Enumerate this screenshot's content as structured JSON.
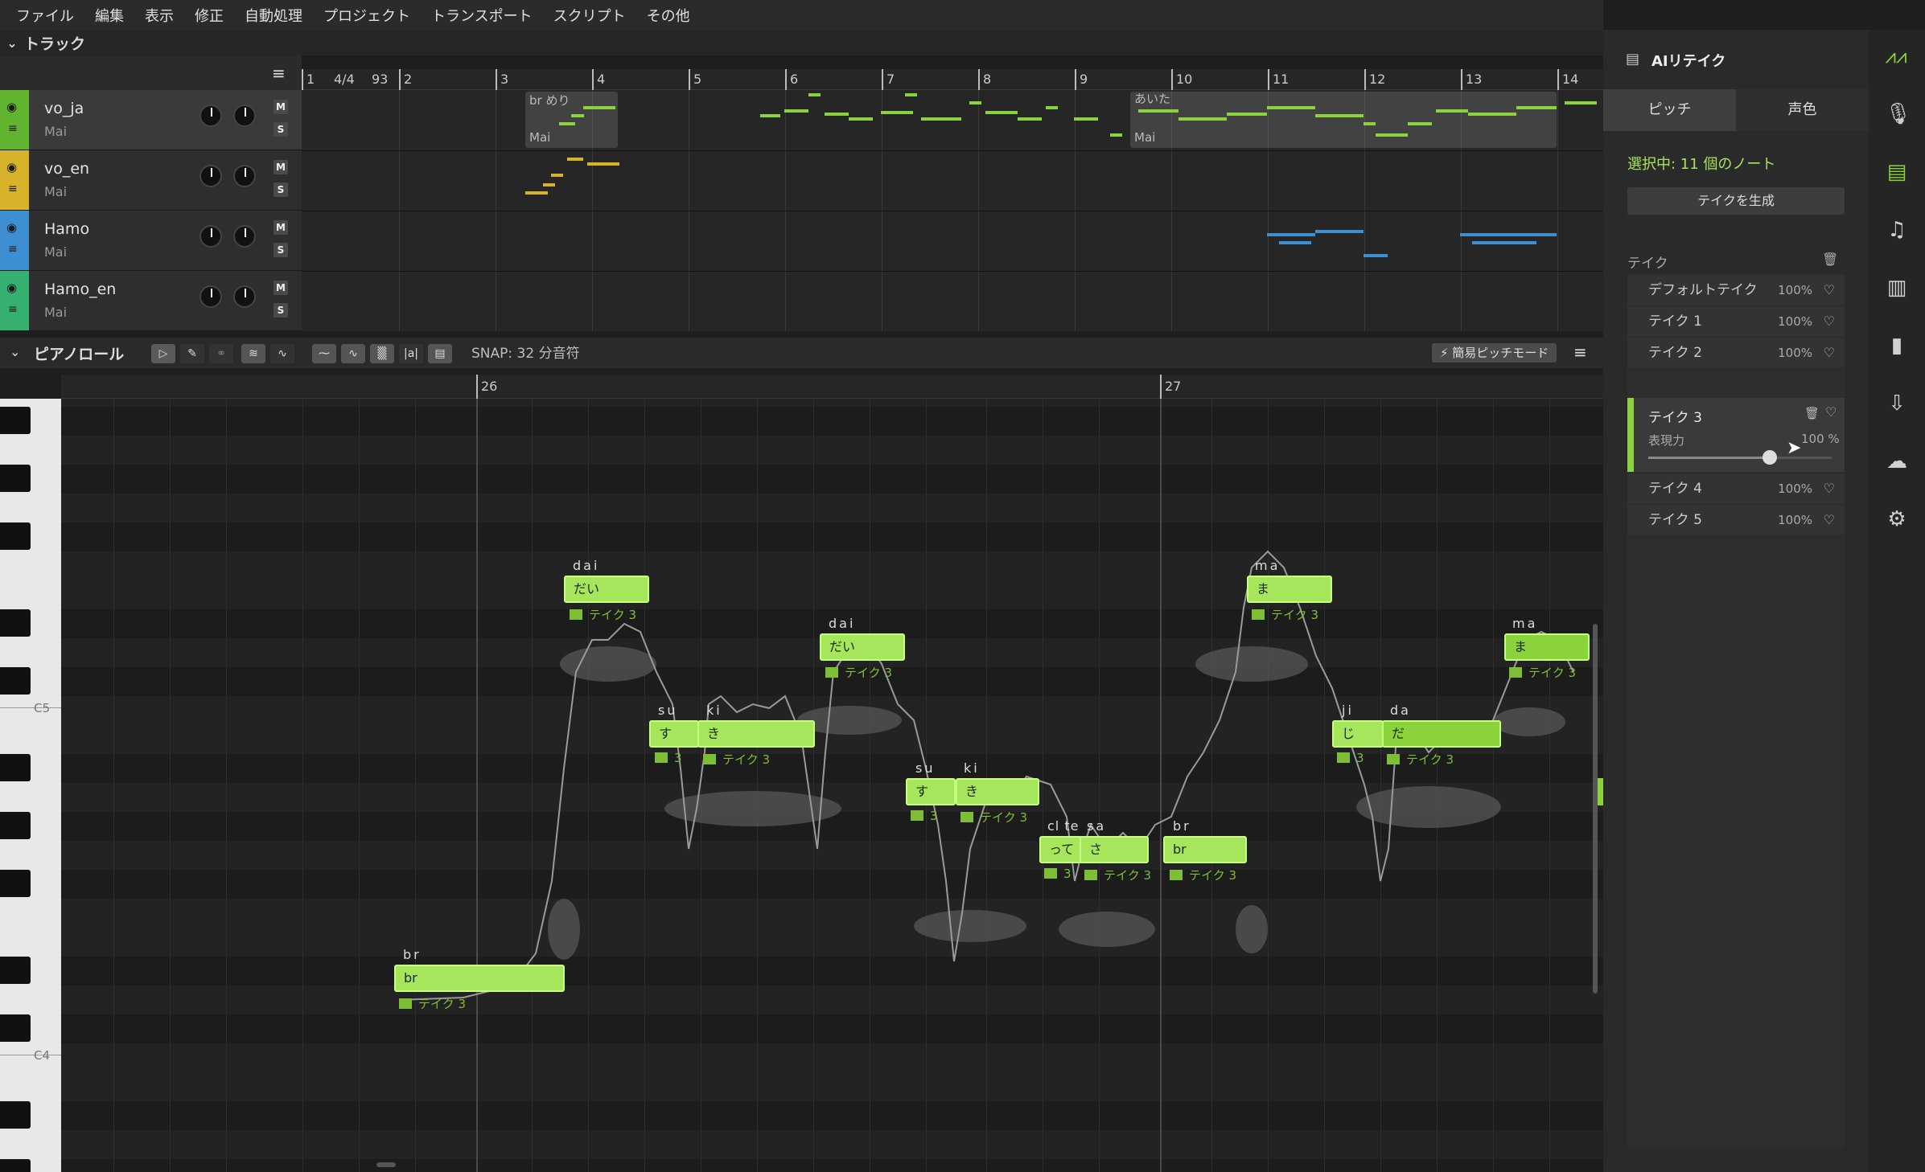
{
  "menu": [
    "ファイル",
    "編集",
    "表示",
    "修正",
    "自動処理",
    "プロジェクト",
    "トランスポート",
    "スクリプト",
    "その他"
  ],
  "tracks_section": {
    "title": "トラック"
  },
  "ruler": {
    "time_sig": "4/4",
    "tempo": "93",
    "bars": [
      "1",
      "2",
      "3",
      "4",
      "5",
      "6",
      "7",
      "8",
      "9",
      "10",
      "11",
      "12",
      "13",
      "14"
    ]
  },
  "tracks": [
    {
      "name": "vo_ja",
      "singer": "Mai",
      "color": "#62b32f"
    },
    {
      "name": "vo_en",
      "singer": "Mai",
      "color": "#d6b32a"
    },
    {
      "name": "Hamo",
      "singer": "Mai",
      "color": "#3d8fd1"
    },
    {
      "name": "Hamo_en",
      "singer": "Mai",
      "color": "#35b070"
    }
  ],
  "clips": {
    "clip1_label": "br めり",
    "clip1_sub": "Mai",
    "clip2_label": "あいた",
    "clip2_sub": "Mai"
  },
  "pianoroll": {
    "title": "ピアノロール",
    "snap_label": "SNAP:",
    "snap_value": "32 分音符",
    "easy_pitch": "⚡ 簡易ピッチモード",
    "lyric_btn": "|a|",
    "bars": [
      "26",
      "27"
    ],
    "key_c5": "C5",
    "key_c4": "C4"
  },
  "notes": [
    {
      "phoneme": "br",
      "lyric": "br",
      "take": "テイク 3"
    },
    {
      "phoneme": "dai",
      "lyric": "だい",
      "take": "テイク 3"
    },
    {
      "phoneme": "su",
      "lyric": "す",
      "take": "3"
    },
    {
      "phoneme": "ki",
      "lyric": "き",
      "take": "テイク 3"
    },
    {
      "phoneme": "dai",
      "lyric": "だい",
      "take": "テイク 3"
    },
    {
      "phoneme": "su",
      "lyric": "す",
      "take": "3"
    },
    {
      "phoneme": "ki",
      "lyric": "き",
      "take": "テイク 3"
    },
    {
      "phoneme": "cl te",
      "lyric": "って",
      "take": "3"
    },
    {
      "phoneme": "sa",
      "lyric": "さ",
      "take": "テイク 3"
    },
    {
      "phoneme": "br",
      "lyric": "br",
      "take": "テイク 3"
    },
    {
      "phoneme": "ma",
      "lyric": "ま",
      "take": "テイク 3"
    },
    {
      "phoneme": "ji",
      "lyric": "じ",
      "take": "3"
    },
    {
      "phoneme": "da",
      "lyric": "だ",
      "take": "テイク 3"
    },
    {
      "phoneme": "ma",
      "lyric": "ま",
      "take": "テイク 3"
    }
  ],
  "ai_retake": {
    "title": "AIリテイク",
    "tab_pitch": "ピッチ",
    "tab_timbre": "声色",
    "selection": "選択中: 11 個のノート",
    "generate": "テイクを生成",
    "takes_header": "テイク",
    "takes": [
      {
        "name": "デフォルトテイク",
        "pct": "100%"
      },
      {
        "name": "テイク 1",
        "pct": "100%"
      },
      {
        "name": "テイク 2",
        "pct": "100%"
      },
      {
        "name": "テイク 4",
        "pct": "100%"
      },
      {
        "name": "テイク 5",
        "pct": "100%"
      }
    ],
    "active_take": {
      "name": "テイク 3",
      "param": "表現力",
      "value": "100 %",
      "level": 1.0
    }
  }
}
